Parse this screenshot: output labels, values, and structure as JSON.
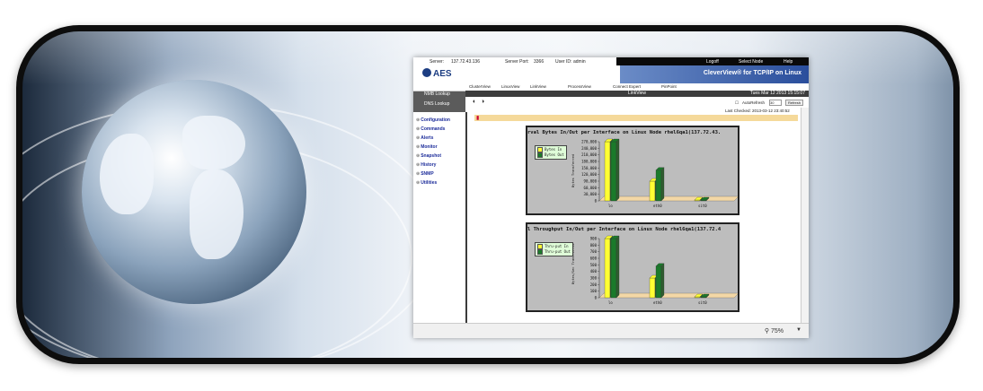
{
  "header": {
    "server_label": "Server:",
    "server_value": "137.72.43.136",
    "port_label": "Server Port:",
    "port_value": "3366",
    "user_label": "User ID:",
    "user_value": "admin",
    "menu": [
      "Logoff",
      "Select Node",
      "Help"
    ]
  },
  "brand": {
    "logo": "AES",
    "product": "CleverView® for TCP/IP on Linux"
  },
  "nav": {
    "items": [
      "ClusterView",
      "LinuxView",
      "LinkView",
      "ProcessView",
      "Connect Expert",
      "PinPoint"
    ]
  },
  "page": {
    "title": "LinkView",
    "datetime": "Tues Mar 12 2013 15:15:07",
    "autorefresh_label": "AutoRefresh",
    "autorefresh_value": "30",
    "refresh_button": "Refresh",
    "last_checked": "Last Checked: 2013-03-12 23:40:52",
    "zoom": "75%"
  },
  "sidebar": {
    "lookups": [
      "NMB Lookup",
      "DNS Lookup"
    ],
    "items": [
      "Configuration",
      "Commands",
      "Alerts",
      "Monitor",
      "Snapshot",
      "History",
      "SNMP",
      "Utilities"
    ]
  },
  "colors": {
    "yellow": "#ffff33",
    "green": "#1a7a2a",
    "floor": "#f3d7a6",
    "chart_bg": "#bdbdbd"
  },
  "chart_data": [
    {
      "type": "bar",
      "title": "rval Bytes In/Out per Interface on Linux Node rhel6qa1(137.72.43.",
      "ylabel": "Bytes Transferred",
      "categories": [
        "lo",
        "eth0",
        "sit0"
      ],
      "series": [
        {
          "name": "Bytes In",
          "values": [
            270000,
            90000,
            0
          ]
        },
        {
          "name": "Bytes Out",
          "values": [
            270000,
            140000,
            0
          ]
        }
      ],
      "yticks": [
        "0",
        "30,000",
        "60,000",
        "90,000",
        "120,000",
        "150,000",
        "180,000",
        "210,000",
        "240,000",
        "270,000"
      ],
      "ylim": [
        0,
        270000
      ]
    },
    {
      "type": "bar",
      "title": "l Throughput In/Out per Interface on Linux Node rhel6qa1(137.72.4",
      "ylabel": "Bytes/Sec Transferred",
      "categories": [
        "lo",
        "eth0",
        "sit0"
      ],
      "series": [
        {
          "name": "Thru-put In",
          "values": [
            900,
            300,
            0
          ]
        },
        {
          "name": "Thru-put Out",
          "values": [
            900,
            480,
            0
          ]
        }
      ],
      "yticks": [
        "0",
        "100",
        "200",
        "300",
        "400",
        "500",
        "600",
        "700",
        "800",
        "900"
      ],
      "ylim": [
        0,
        900
      ]
    }
  ]
}
